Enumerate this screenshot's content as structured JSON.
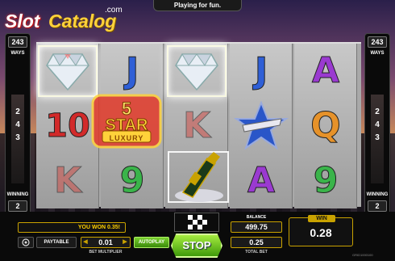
{
  "logo": {
    "part1": "Slot",
    "part2": "Catalog",
    "suffix": ".com"
  },
  "banner": "Playing for fun.",
  "ways_panel": {
    "top_number": "243",
    "top_label": "WAYS",
    "digits": [
      "2",
      "4",
      "3"
    ],
    "bottom_label": "WINNING",
    "bottom_number": "2"
  },
  "reels": [
    [
      "diamond",
      "10",
      "K"
    ],
    [
      "J",
      "5 STAR",
      "9"
    ],
    [
      "diamond",
      "K",
      "champagne"
    ],
    [
      "J",
      "star",
      "A"
    ],
    [
      "A",
      "Q",
      "9"
    ]
  ],
  "stamp": {
    "line1": "5",
    "line2": "STAR",
    "line3": "LUXURY"
  },
  "bottom": {
    "message": "YOU WON 0.35!",
    "paytable": "PAYTABLE",
    "bet_value": "0.01",
    "bet_label": "BET MULTIPLIER",
    "autoplay": "AUTOPLAY",
    "stop": "STOP",
    "balance_label": "BALANCE",
    "balance_value": "499.75",
    "total_bet_label": "TOTAL BET",
    "total_bet_value": "0.25",
    "win_label": "WIN",
    "win_value": "0.28",
    "game_id": "GRID1000100"
  },
  "colors": {
    "accent_gold": "#c9a200",
    "button_green": "#5fb81c"
  }
}
